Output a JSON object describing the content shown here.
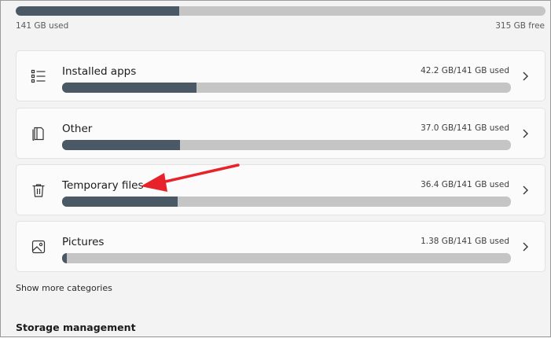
{
  "storage": {
    "used_label": "141 GB used",
    "free_label": "315 GB free",
    "used_fraction": 0.309
  },
  "categories": [
    {
      "name": "Installed apps",
      "size": "42.2 GB/141 GB used",
      "fraction": 0.299,
      "icon": "list-icon"
    },
    {
      "name": "Other",
      "size": "37.0 GB/141 GB used",
      "fraction": 0.262,
      "icon": "document-icon"
    },
    {
      "name": "Temporary files",
      "size": "36.4 GB/141 GB used",
      "fraction": 0.258,
      "icon": "trash-icon"
    },
    {
      "name": "Pictures",
      "size": "1.38 GB/141 GB used",
      "fraction": 0.01,
      "icon": "image-icon"
    }
  ],
  "show_more_label": "Show more categories",
  "storage_management_title": "Storage management",
  "colors": {
    "bar_fill": "#4b5966",
    "bar_track": "#c5c5c5",
    "annotation_arrow": "#e8222a"
  }
}
